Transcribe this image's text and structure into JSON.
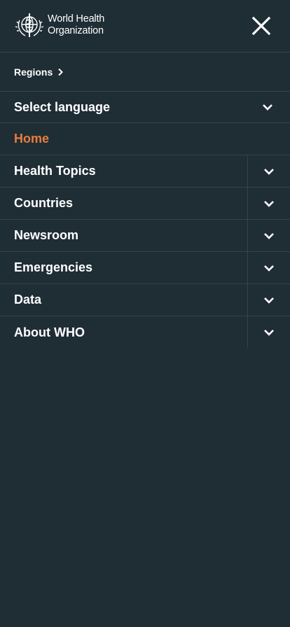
{
  "header": {
    "logo_line1": "World Health",
    "logo_line2": "Organization",
    "close_label": "Close menu"
  },
  "regions": {
    "label": "Regions"
  },
  "language": {
    "label": "Select language"
  },
  "home": {
    "label": "Home"
  },
  "menu": [
    {
      "label": "Health Topics"
    },
    {
      "label": "Countries"
    },
    {
      "label": "Newsroom"
    },
    {
      "label": "Emergencies"
    },
    {
      "label": "Data"
    },
    {
      "label": "About WHO"
    }
  ],
  "colors": {
    "background": "#1f2d35",
    "accent": "#e67e3b",
    "divider": "#34444d"
  }
}
